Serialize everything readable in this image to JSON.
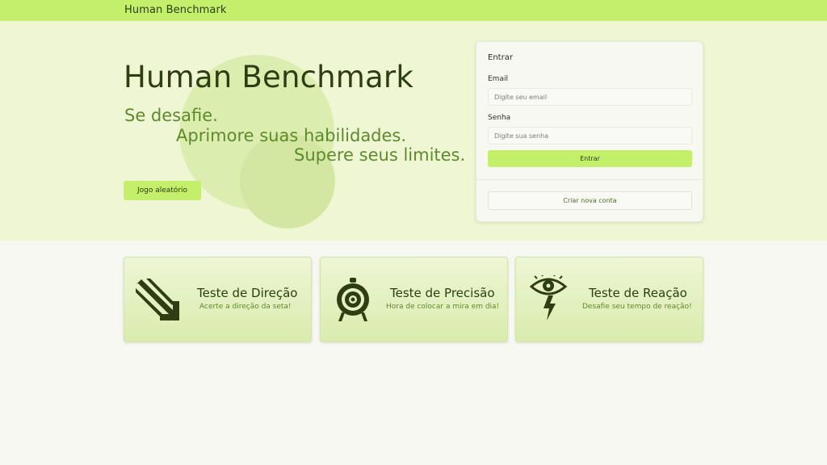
{
  "navbar": {
    "brand": "Human Benchmark"
  },
  "hero": {
    "title": "Human Benchmark",
    "taglines": [
      "Se desafie.",
      "Aprimore suas habilidades.",
      "Supere seus limites."
    ],
    "random_button": "Jogo aleatório"
  },
  "login": {
    "title": "Entrar",
    "email_label": "Email",
    "email_placeholder": "Digite seu email",
    "password_label": "Senha",
    "password_placeholder": "Digite sua senha",
    "submit_label": "Entrar",
    "create_account_label": "Criar nova conta"
  },
  "games": [
    {
      "title": "Teste de Direção",
      "subtitle": "Acerte a direção da seta!",
      "icon": "arrow-down-right-icon"
    },
    {
      "title": "Teste de Precisão",
      "subtitle": "Hora de colocar a mira em dia!",
      "icon": "target-icon"
    },
    {
      "title": "Teste de Reação",
      "subtitle": "Desafie seu tempo de reação!",
      "icon": "eye-lightning-icon"
    }
  ],
  "colors": {
    "accent": "#c3ef6a",
    "hero_bg": "#eef6d4",
    "page_bg": "#f7f8f2",
    "text_dark": "#2e3d12",
    "text_green": "#5f8a2c"
  }
}
